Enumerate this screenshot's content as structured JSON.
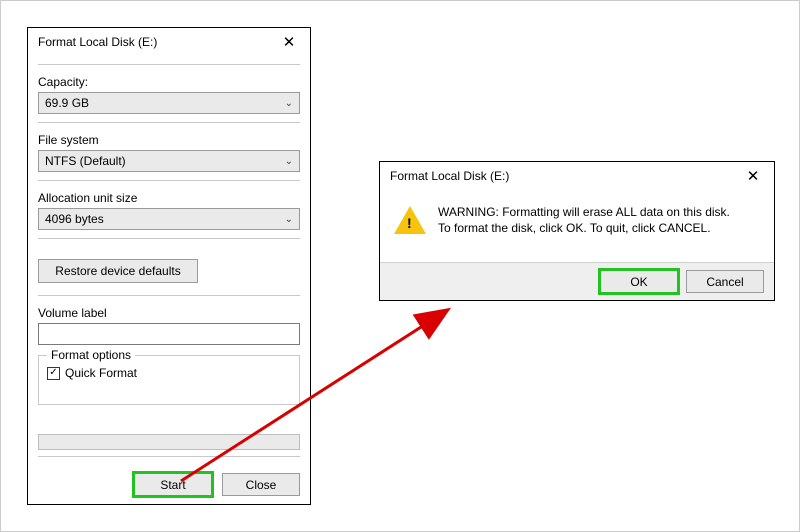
{
  "formatDialog": {
    "title": "Format Local Disk (E:)",
    "capacityLabel": "Capacity:",
    "capacityValue": "69.9 GB",
    "fileSystemLabel": "File system",
    "fileSystemValue": "NTFS (Default)",
    "allocationLabel": "Allocation unit size",
    "allocationValue": "4096 bytes",
    "restoreDefaults": "Restore device defaults",
    "volumeLabelLabel": "Volume label",
    "volumeLabelValue": "",
    "formatOptionsLegend": "Format options",
    "quickFormatLabel": "Quick Format",
    "quickFormatChecked": true,
    "startButton": "Start",
    "closeButton": "Close"
  },
  "confirmDialog": {
    "title": "Format Local Disk (E:)",
    "line1": "WARNING: Formatting will erase ALL data on this disk.",
    "line2": "To format the disk, click OK. To quit, click CANCEL.",
    "okButton": "OK",
    "cancelButton": "Cancel"
  },
  "glyphs": {
    "close": "✕",
    "chevronDown": "⌄",
    "check": "✓"
  }
}
